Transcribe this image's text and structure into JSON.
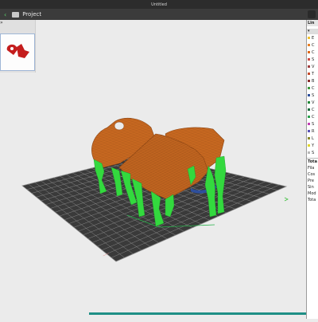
{
  "window": {
    "title": "Untitled"
  },
  "menubar": {
    "project_label": "Project",
    "back_glyph": "‹"
  },
  "thumbnails": {
    "scroll_glyph": "»"
  },
  "legend": {
    "header": "Lin",
    "items": [
      {
        "label": "E",
        "color": "#f2c230"
      },
      {
        "label": "C",
        "color": "#e98024"
      },
      {
        "label": "C",
        "color": "#e06a1c"
      },
      {
        "label": "S",
        "color": "#ce4b43"
      },
      {
        "label": "V",
        "color": "#a13d3d"
      },
      {
        "label": "T",
        "color": "#c54a2a"
      },
      {
        "label": "B",
        "color": "#8b2e2e"
      },
      {
        "label": "C",
        "color": "#3c9a3c"
      },
      {
        "label": "S",
        "color": "#2e4f9c"
      },
      {
        "label": "V",
        "color": "#25893a"
      },
      {
        "label": "C",
        "color": "#1a6b3c"
      },
      {
        "label": "C",
        "color": "#28a04b"
      },
      {
        "label": "S",
        "color": "#c23db4"
      },
      {
        "label": "R",
        "color": "#5a54b8"
      },
      {
        "label": "L",
        "color": "#8a8a2a"
      },
      {
        "label": "Y",
        "color": "#e2d72c"
      },
      {
        "label": "S",
        "color": "#b8b8b8"
      }
    ],
    "stats_title": "Tota",
    "stats": [
      "Fila",
      "Cos",
      "Pre",
      "Sin",
      "Mod",
      "Tota"
    ]
  },
  "colors": {
    "part": "#cf6d22",
    "support": "#33d93e",
    "bed": "#3a3a3a",
    "bed_grid": "#9a9a9a",
    "accent": "#1e8f86"
  }
}
